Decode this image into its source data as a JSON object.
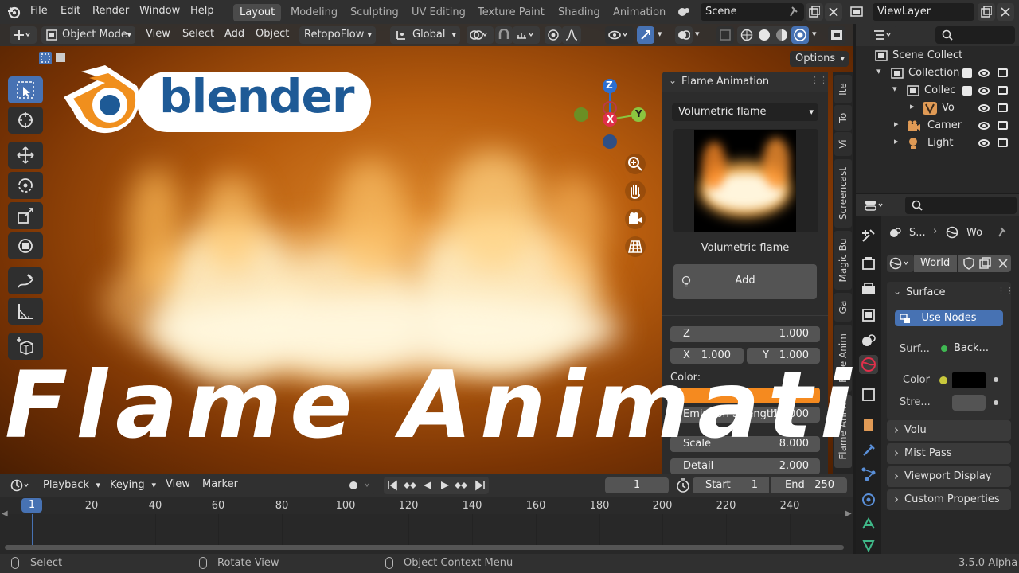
{
  "menubar": {
    "items": [
      "File",
      "Edit",
      "Render",
      "Window",
      "Help"
    ],
    "workspaces": [
      "Layout",
      "Modeling",
      "Sculpting",
      "UV Editing",
      "Texture Paint",
      "Shading",
      "Animation"
    ],
    "active_workspace": "Layout",
    "scene": "Scene",
    "view_layer": "ViewLayer"
  },
  "viewport_header": {
    "mode": "Object Mode",
    "menus": [
      "View",
      "Select",
      "Add",
      "Object"
    ],
    "addon_menu": "RetopoFlow",
    "orientation": "Global",
    "options_label": "Options"
  },
  "gizmo": {
    "z": "Z",
    "y": "Y",
    "x": "X"
  },
  "logo_text": "blender",
  "overlay_title": "Flame Animation",
  "side_tabs": [
    "Ite",
    "To",
    "Vi",
    "Screencast",
    "Magic Bu",
    "Ga",
    "Face Anim",
    "Flame Anim"
  ],
  "flame_panel": {
    "header": "Flame Animation",
    "preset_dropdown": "Volumetric flame",
    "preview_caption": "Volumetric flame",
    "add_button": "Add",
    "z_label": "Z",
    "z_value": "1.000",
    "x_label": "X",
    "x_value": "1.000",
    "y_label": "Y",
    "y_value": "1.000",
    "color_label": "Color:",
    "color_value": "#f58a1f",
    "emission_label": "Emission Strength",
    "emission_value": "10.000",
    "scale_label": "Scale",
    "scale_value": "8.000",
    "detail_label": "Detail",
    "detail_value": "2.000"
  },
  "outliner": {
    "rows": [
      {
        "label": "Scene Collect"
      },
      {
        "label": "Collection"
      },
      {
        "label": "Collec"
      },
      {
        "label": "Vo"
      },
      {
        "label": "Camer"
      },
      {
        "label": "Light"
      }
    ]
  },
  "properties": {
    "breadcrumb_a": "S...",
    "breadcrumb_b": "Wo",
    "world_name": "World",
    "surface_header": "Surface",
    "use_nodes": "Use Nodes",
    "surface_label": "Surf...",
    "surface_value": "Back...",
    "color_label": "Color",
    "strength_label": "Stre...",
    "volume_header": "Volu",
    "mist_pass": "Mist Pass",
    "viewport_display": "Viewport Display",
    "custom_properties": "Custom Properties"
  },
  "timeline": {
    "menus": [
      "Playback",
      "Keying",
      "View",
      "Marker"
    ],
    "current_frame": "1",
    "start_label": "Start",
    "start_value": "1",
    "end_label": "End",
    "end_value": "250",
    "playhead": "1",
    "ruler": [
      "20",
      "40",
      "60",
      "80",
      "100",
      "120",
      "140",
      "160",
      "180",
      "200",
      "220",
      "240"
    ]
  },
  "statusbar": {
    "select": "Select",
    "rotate": "Rotate View",
    "context": "Object Context Menu",
    "version": "3.5.0 Alpha"
  },
  "colors": {
    "accent_blue": "#4772b3",
    "logo_orange": "#f08f1d",
    "logo_blue": "#1e5a96"
  }
}
